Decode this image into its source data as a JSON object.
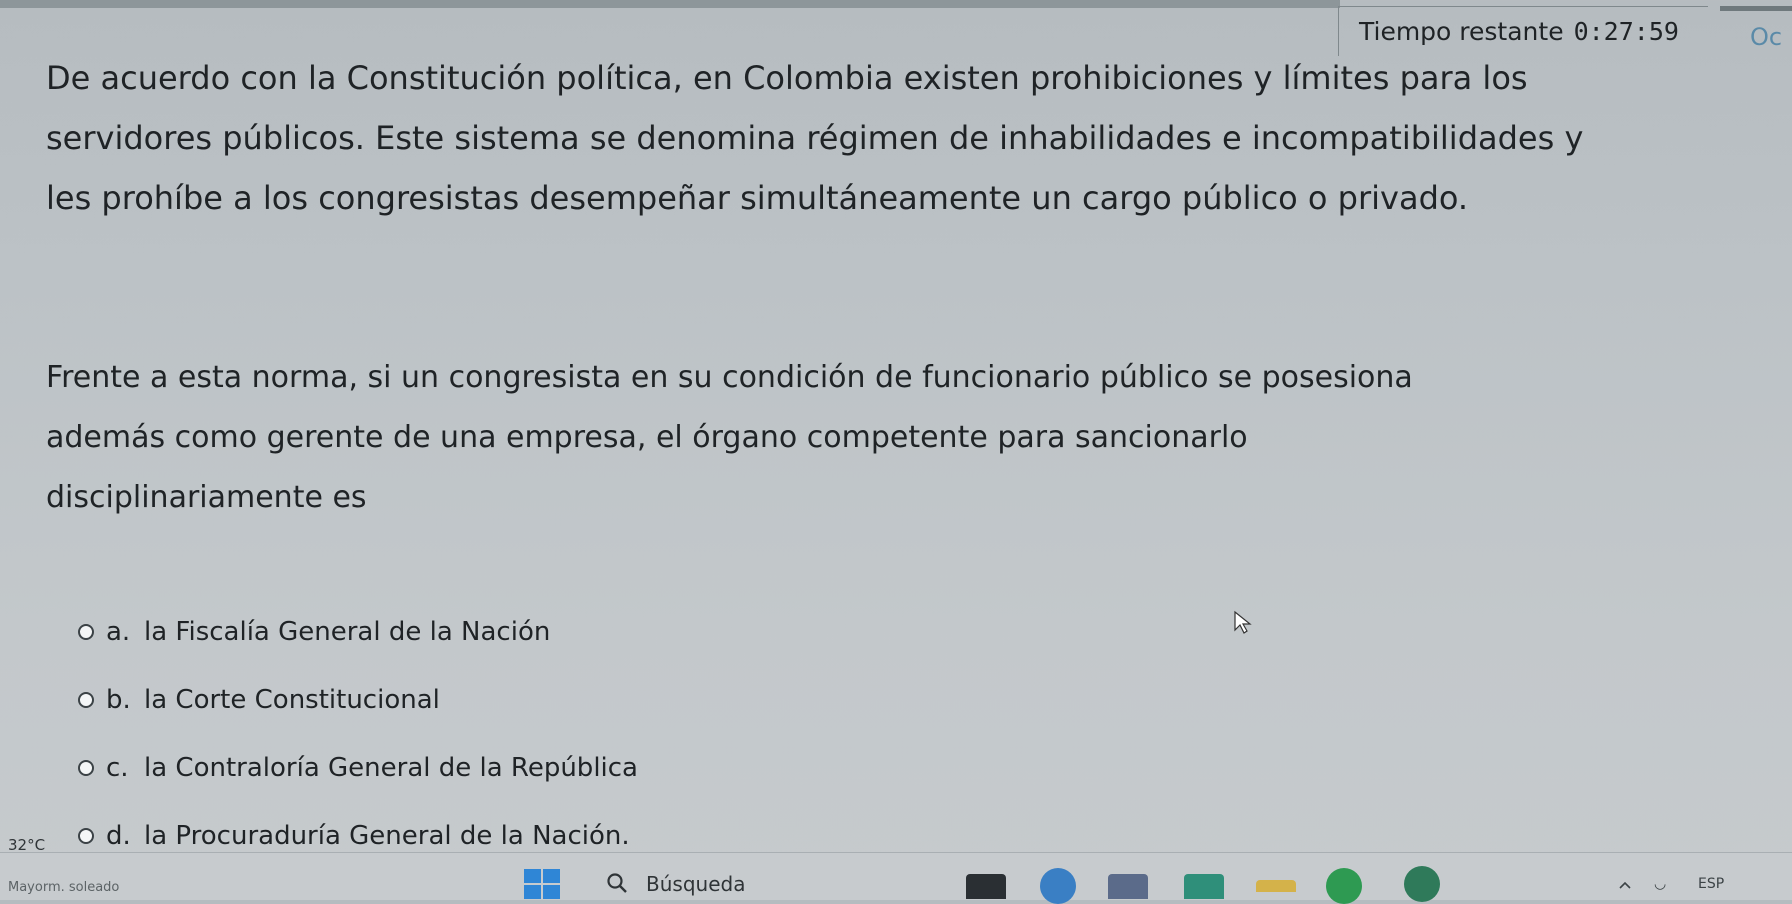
{
  "header": {
    "timer_label": "Tiempo restante",
    "timer_value": "0:27:59",
    "corner_text": "Oc"
  },
  "question": {
    "lines": [
      "De acuerdo con la Constitución política, en Colombia existen prohibiciones y límites para los",
      "servidores públicos. Este sistema se denomina régimen de inhabilidades e incompatibilidades y",
      "les prohíbe a los congresistas desempeñar simultáneamente un cargo público o privado."
    ],
    "prompt_lines": [
      "Frente a esta norma, si un congresista en su condición de funcionario público se posesiona",
      "además como gerente de una empresa, el órgano competente para sancionarlo",
      "disciplinariamente es"
    ]
  },
  "options": [
    {
      "letter": "a.",
      "text": "la Fiscalía General de la Nación"
    },
    {
      "letter": "b.",
      "text": "la Corte Constitucional"
    },
    {
      "letter": "c.",
      "text": "la Contraloría General de la República"
    },
    {
      "letter": "d.",
      "text": "la Procuraduría General de la Nación."
    }
  ],
  "taskbar": {
    "temperature": "32°C",
    "weather": "Mayorm. soleado",
    "search_label": "Búsqueda",
    "language": "ESP"
  },
  "colors": {
    "accent": "#5a8aa8",
    "background": "#bcc2c6"
  }
}
